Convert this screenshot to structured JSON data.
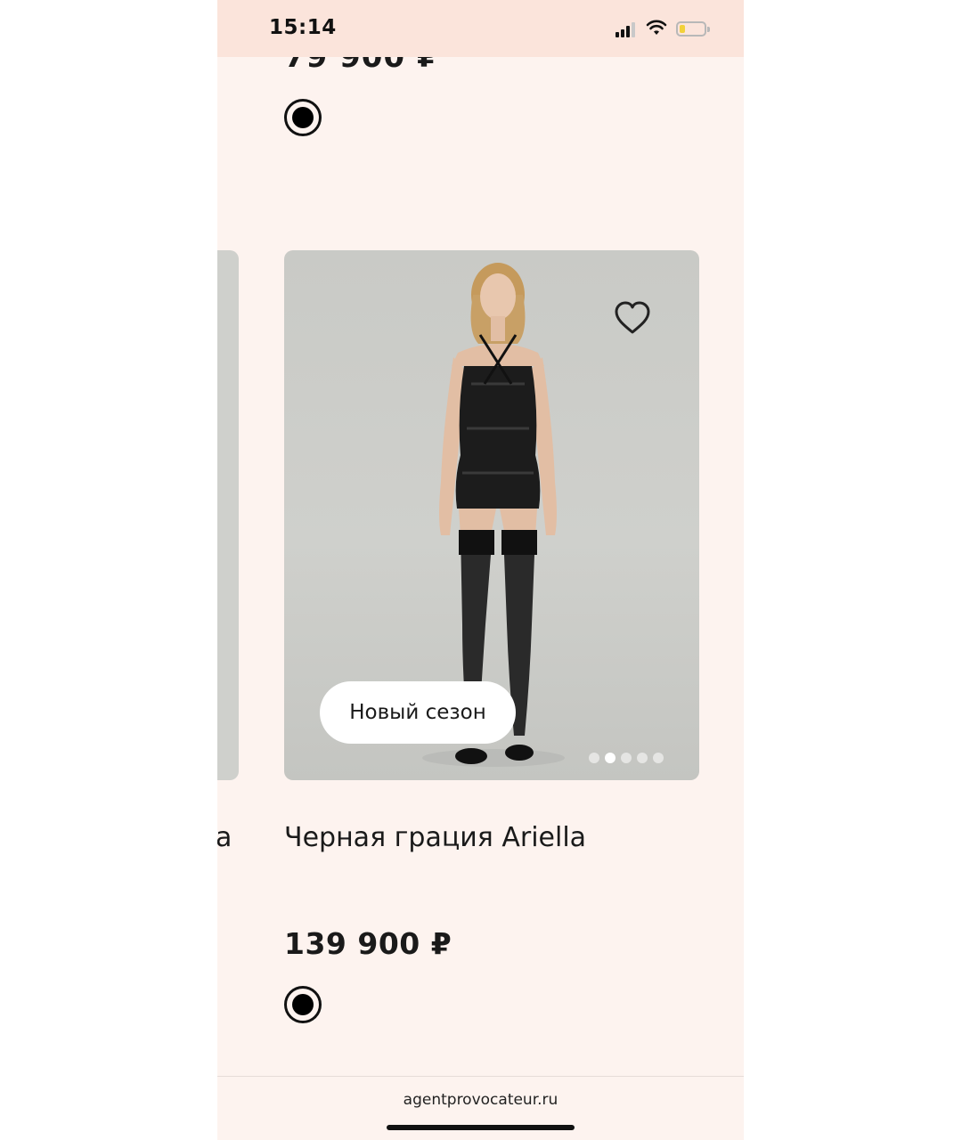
{
  "status_bar": {
    "time": "15:14"
  },
  "previous_product": {
    "price": "79 900 ₽",
    "title_tail": "a"
  },
  "product": {
    "title": "Черная грация Ariella",
    "price": "139 900 ₽",
    "badge": "Новый сезон",
    "image_dots": {
      "count": 5,
      "active_index": 1
    },
    "favorite_icon": "heart-outline-icon",
    "color_swatch": "#000000"
  },
  "browser": {
    "url": "agentprovocateur.ru"
  }
}
